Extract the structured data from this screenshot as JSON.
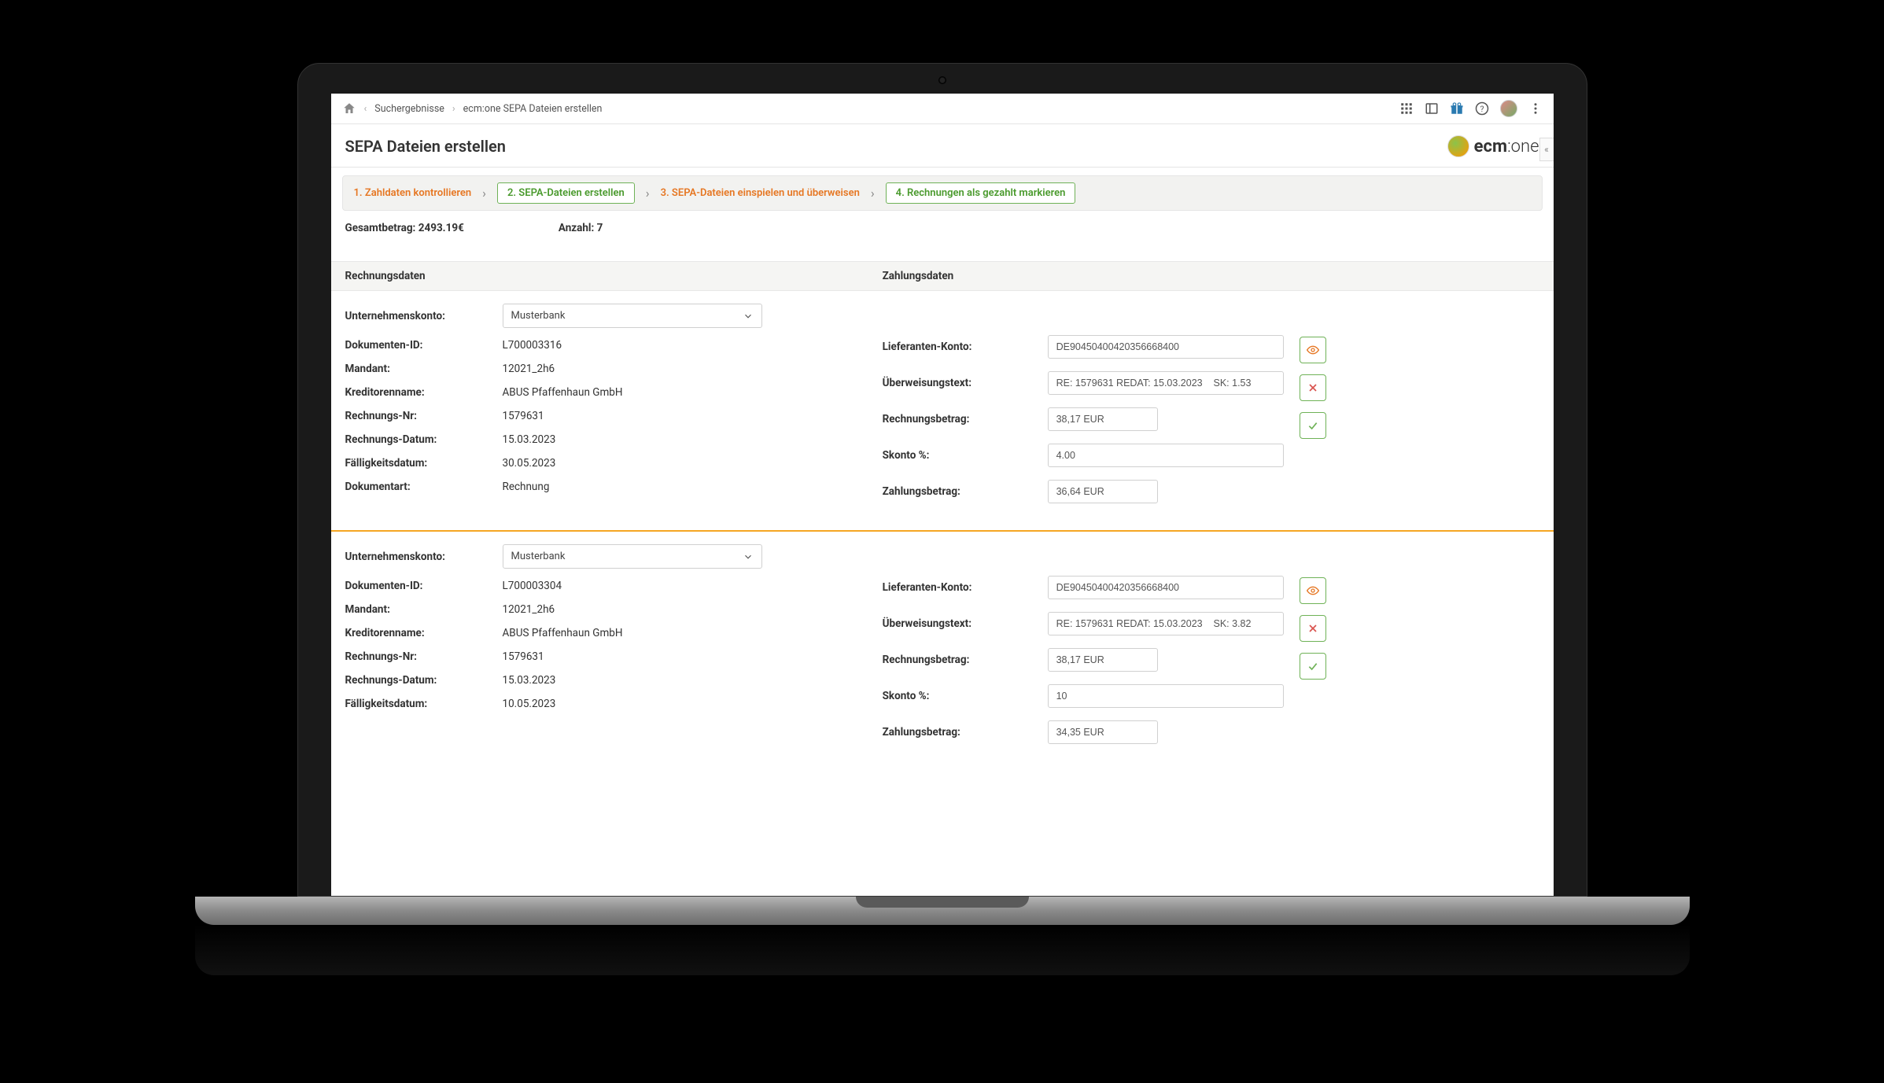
{
  "breadcrumb": {
    "search_results": "Suchergebnisse",
    "current": "ecm:one SEPA Dateien erstellen"
  },
  "page_title": "SEPA Dateien erstellen",
  "logo_text_a": "ecm",
  "logo_text_b": ":one",
  "wizard": {
    "step1": "1. Zahldaten kontrollieren",
    "step2": "2. SEPA-Dateien erstellen",
    "step3": "3. SEPA-Dateien einspielen und überweisen",
    "step4": "4. Rechnungen als gezahlt markieren"
  },
  "summary": {
    "total_label": "Gesamtbetrag:",
    "total_value": "2493.19€",
    "count_label": "Anzahl:",
    "count_value": "7"
  },
  "section_heads": {
    "left": "Rechnungsdaten",
    "right": "Zahlungsdaten"
  },
  "labels": {
    "company_account": "Unternehmenskonto:",
    "doc_id": "Dokumenten-ID:",
    "mandant": "Mandant:",
    "kreditor": "Kreditorenname:",
    "rechnung_nr": "Rechnungs-Nr:",
    "rechnung_datum": "Rechnungs-Datum:",
    "faelligkeit": "Fälligkeitsdatum:",
    "dokumentart": "Dokumentart:",
    "lieferanten_konto": "Lieferanten-Konto:",
    "ueberweisungstext": "Überweisungstext:",
    "rechnungsbetrag": "Rechnungsbetrag:",
    "skonto": "Skonto %:",
    "zahlungsbetrag": "Zahlungsbetrag:"
  },
  "entries": [
    {
      "bank": "Musterbank",
      "doc_id": "L700003316",
      "mandant": "12021_2h6",
      "kreditor": "ABUS Pfaffenhaun GmbH",
      "rechnung_nr": "1579631",
      "rechnung_datum": "15.03.2023",
      "faelligkeit": "30.05.2023",
      "dokumentart": "Rechnung",
      "lieferanten_konto": "DE90450400420356668400",
      "ueberweisungstext": "RE: 1579631 REDAT: 15.03.2023    SK: 1.53",
      "rechnungsbetrag": "38,17 EUR",
      "skonto": "4.00",
      "zahlungsbetrag": "36,64 EUR"
    },
    {
      "bank": "Musterbank",
      "doc_id": "L700003304",
      "mandant": "12021_2h6",
      "kreditor": "ABUS Pfaffenhaun GmbH",
      "rechnung_nr": "1579631",
      "rechnung_datum": "15.03.2023",
      "faelligkeit": "10.05.2023",
      "dokumentart": "",
      "lieferanten_konto": "DE90450400420356668400",
      "ueberweisungstext": "RE: 1579631 REDAT: 15.03.2023    SK: 3.82",
      "rechnungsbetrag": "38,17 EUR",
      "skonto": "10",
      "zahlungsbetrag": "34,35 EUR"
    }
  ]
}
